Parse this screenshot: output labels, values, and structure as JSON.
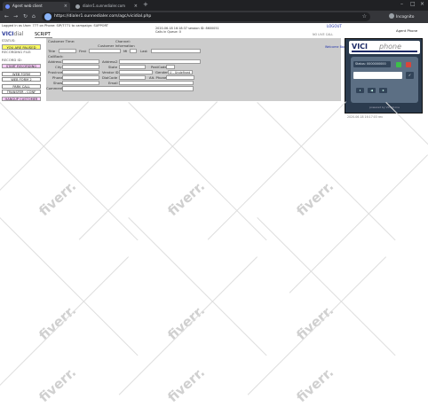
{
  "browser": {
    "tabs": [
      {
        "label": "Agent web client",
        "active": true
      },
      {
        "label": "dialer1.sunnedialer.com",
        "active": false
      }
    ],
    "url": "https://dialer1.sunnedialer.com/agc/vicidial.php",
    "profile": "Incognito",
    "new_tab": "+"
  },
  "header": {
    "logged_in": "Logged in as User: 777 on Phone: SIP/7771 to campaign: SUPPORT",
    "session_line": "2020-06-18 16:18:37   session ID: 8600051",
    "calls_queue": "Calls in Queue: 0",
    "logout": "LOGOUT",
    "agent_phone": "Agent Phone",
    "no_live": "NO LIVE CALL",
    "right_link": "Welcome Back"
  },
  "brand": {
    "vici": "VICI",
    "dial": "dial",
    "script_tab": "SCRIPT"
  },
  "left": {
    "status_label": "STATUS:",
    "paused_button": "YOU ARE PAUSED",
    "recording_file": "RECORDING FILE:",
    "record_id": "RECORD ID:",
    "start_recording": "START RECORDING",
    "web_form": "WEB FORM",
    "web_form2": "WEB FORM 2",
    "park_call": "PARK CALL",
    "transfer_conf": "TRANSFER - CONF",
    "hangup_customer": "HANGUP CUSTOMER"
  },
  "form": {
    "customer_time": "Customer Time:",
    "channel": "Channel:",
    "customer_information": "Customer Information",
    "title": "Title",
    "first": "First",
    "mi": "MI",
    "last": "Last",
    "callback": "CallBack:",
    "address": "Address1",
    "address2": "Address2",
    "city": "City",
    "state": "State",
    "postcode": "PostCode",
    "province": "Province",
    "vendor_id": "Vendor ID",
    "gender": "Gender",
    "gender_value": "U - Undefined",
    "phone": "Phone",
    "dialcode": "DialCode",
    "alt_phone": "Alt. Phone",
    "show": "Show",
    "email": "Email",
    "comments": "Comments"
  },
  "softphone": {
    "brand_vici": "VICI",
    "brand_phone": "phone",
    "status": "Status:   0000000000",
    "ok_label": "✓",
    "controls": [
      "⏸",
      "◀",
      "⏹"
    ],
    "footer": "powered by VICIphone",
    "version": "2020-06-18 16:17:03 rev"
  },
  "watermark": {
    "text": "fiverr."
  },
  "colors": {
    "tab_bg": "#202124",
    "toolbar_bg": "#35363a",
    "panel_gray": "#cccccc",
    "paused_yellow": "#ffff66",
    "record_pink": "#ffccff",
    "phone_bg": "#2b3b4e"
  }
}
